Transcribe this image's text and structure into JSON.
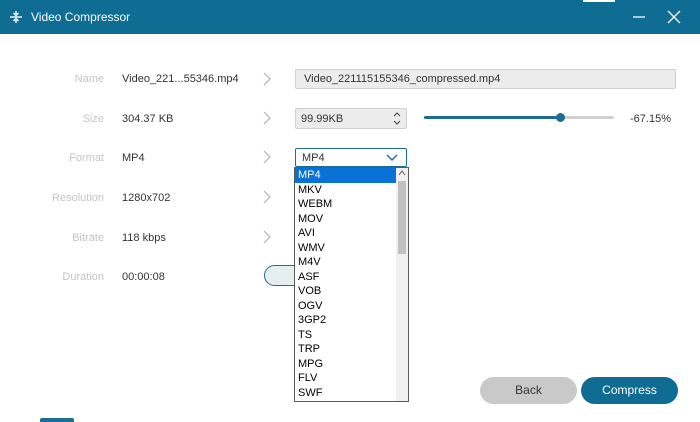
{
  "window": {
    "title": "Video Compressor",
    "icon": "compress-icon"
  },
  "rows": [
    {
      "label": "Name",
      "value": "Video_221...55346.mp4"
    },
    {
      "label": "Size",
      "value": "304.37 KB"
    },
    {
      "label": "Format",
      "value": "MP4"
    },
    {
      "label": "Resolution",
      "value": "1280x702"
    },
    {
      "label": "Bitrate",
      "value": "118 kbps"
    },
    {
      "label": "Duration",
      "value": "00:00:08"
    }
  ],
  "output": {
    "name": "Video_221115155346_compressed.mp4",
    "size": "99.99KB",
    "size_percent": "-67.15%",
    "slider_fraction": 0.72,
    "format": "MP4"
  },
  "format_options": [
    "MP4",
    "MKV",
    "WEBM",
    "MOV",
    "AVI",
    "WMV",
    "M4V",
    "ASF",
    "VOB",
    "OGV",
    "3GP2",
    "TS",
    "TRP",
    "MPG",
    "FLV",
    "SWF"
  ],
  "buttons": {
    "back": "Back",
    "compress": "Compress"
  },
  "colors": {
    "accent": "#0f6c93",
    "selection": "#0a72d6"
  }
}
